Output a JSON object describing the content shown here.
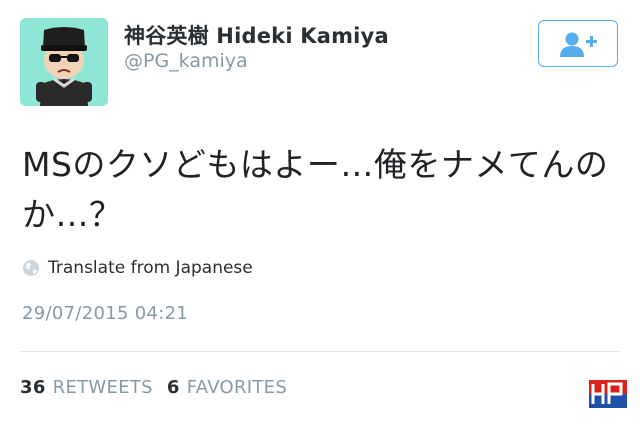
{
  "tweet": {
    "author": {
      "display_name": "神谷英樹 Hideki Kamiya",
      "handle": "@PG_kamiya",
      "avatar_icon": "cartoon-avatar-icon"
    },
    "follow_button_icon": "add-user-icon",
    "text": "MSのクソどもはよー…俺をナメてんのか…？",
    "translate_icon": "globe-icon",
    "translate_label": "Translate from Japanese",
    "timestamp": "29/07/2015 04:21",
    "stats": {
      "retweets_count": "36",
      "retweets_label": "RETWEETS",
      "favorites_count": "6",
      "favorites_label": "FAVORITES"
    }
  },
  "colors": {
    "accent": "#55acee",
    "muted_text": "#8899a6",
    "primary_text": "#292f33",
    "avatar_bg": "#8fe6d4",
    "watermark_red": "#d9231d",
    "watermark_blue": "#1f4fa8"
  }
}
